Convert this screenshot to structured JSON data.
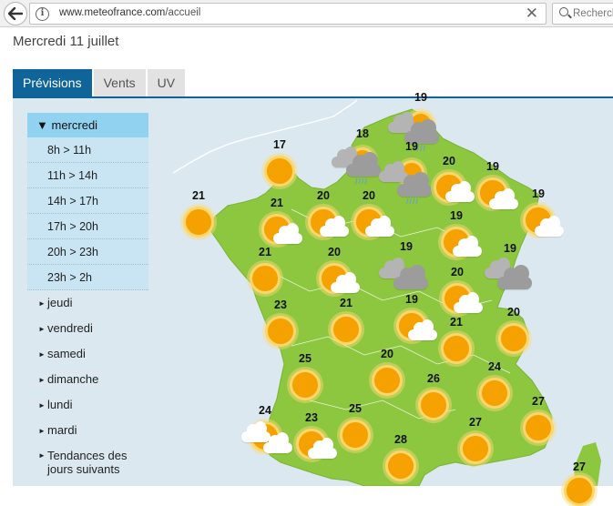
{
  "browser": {
    "url_host": "www.meteofrance.com",
    "url_path": "/accueil",
    "search_placeholder": "Recherch"
  },
  "page": {
    "date": "Mercredi 11 juillet"
  },
  "tabs": [
    {
      "label": "Prévisions",
      "active": true
    },
    {
      "label": "Vents",
      "active": false
    },
    {
      "label": "UV",
      "active": false
    }
  ],
  "sidebar": {
    "active_day": "mercredi",
    "slots": [
      "8h > 11h",
      "11h > 14h",
      "14h > 17h",
      "17h > 20h",
      "20h > 23h",
      "23h > 2h"
    ],
    "days": [
      "jeudi",
      "vendredi",
      "samedi",
      "dimanche",
      "lundi",
      "mardi"
    ],
    "trend": "Tendances des jours suivants"
  },
  "colors": {
    "land": "#8dc63f",
    "sea": "#dbe8f0",
    "tab_active": "#0f6499",
    "sidebar_active": "#91d2f1",
    "sun": "#f5a100"
  },
  "forecast": [
    {
      "temp": "19",
      "icon": "sun-cloud-rain"
    },
    {
      "temp": "17",
      "icon": "sun"
    },
    {
      "temp": "18",
      "icon": "sun-cloud-rain"
    },
    {
      "temp": "19",
      "icon": "sun-cloud-rain"
    },
    {
      "temp": "20",
      "icon": "sun-cloud"
    },
    {
      "temp": "19",
      "icon": "sun-cloud"
    },
    {
      "temp": "19",
      "icon": "sun-cloud"
    },
    {
      "temp": "21",
      "icon": "sun"
    },
    {
      "temp": "21",
      "icon": "sun-cloud"
    },
    {
      "temp": "20",
      "icon": "sun-cloud"
    },
    {
      "temp": "20",
      "icon": "sun-cloud"
    },
    {
      "temp": "19",
      "icon": "sun-cloud"
    },
    {
      "temp": "19",
      "icon": "cloud"
    },
    {
      "temp": "21",
      "icon": "sun"
    },
    {
      "temp": "20",
      "icon": "sun-cloud"
    },
    {
      "temp": "19",
      "icon": "cloud"
    },
    {
      "temp": "20",
      "icon": "sun-cloud"
    },
    {
      "temp": "23",
      "icon": "sun"
    },
    {
      "temp": "21",
      "icon": "sun"
    },
    {
      "temp": "19",
      "icon": "sun-cloud"
    },
    {
      "temp": "21",
      "icon": "sun"
    },
    {
      "temp": "20",
      "icon": "sun"
    },
    {
      "temp": "25",
      "icon": "sun"
    },
    {
      "temp": "20",
      "icon": "sun"
    },
    {
      "temp": "26",
      "icon": "sun"
    },
    {
      "temp": "24",
      "icon": "sun"
    },
    {
      "temp": "24",
      "icon": "sun-cloud"
    },
    {
      "temp": "23",
      "icon": "sun-cloud"
    },
    {
      "temp": "25",
      "icon": "sun"
    },
    {
      "temp": "27",
      "icon": "sun"
    },
    {
      "temp": "27",
      "icon": "sun"
    },
    {
      "temp": "28",
      "icon": "sun"
    },
    {
      "temp": "27",
      "icon": "sun"
    }
  ]
}
